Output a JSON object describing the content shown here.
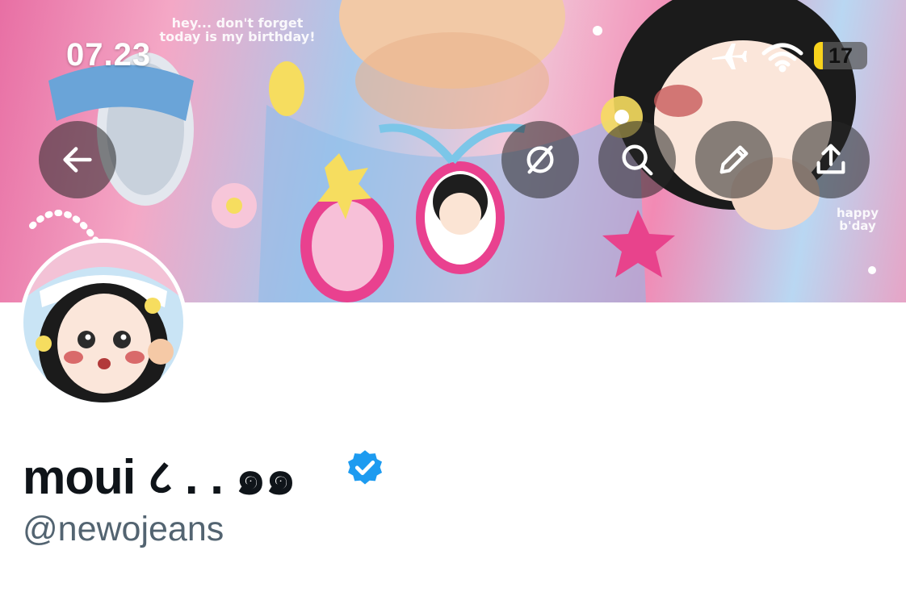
{
  "status_bar": {
    "time": "07.23",
    "battery_percent": "17",
    "battery_level": 0.17,
    "icons": [
      "airplane-icon",
      "wifi-icon",
      "battery-icon"
    ]
  },
  "banner": {
    "caption_top": "hey... don't forget\ntoday is my birthday!",
    "caption_right": "happy\nb'day"
  },
  "toolbar": {
    "back": "back-arrow-icon",
    "actions": [
      "grok-icon",
      "search-icon",
      "edit-icon",
      "share-icon"
    ]
  },
  "profile": {
    "display_name": "moui ८ .  . ๑๑",
    "handle": "@newojeans",
    "verified": true,
    "verified_color": "#1d9bf0"
  }
}
